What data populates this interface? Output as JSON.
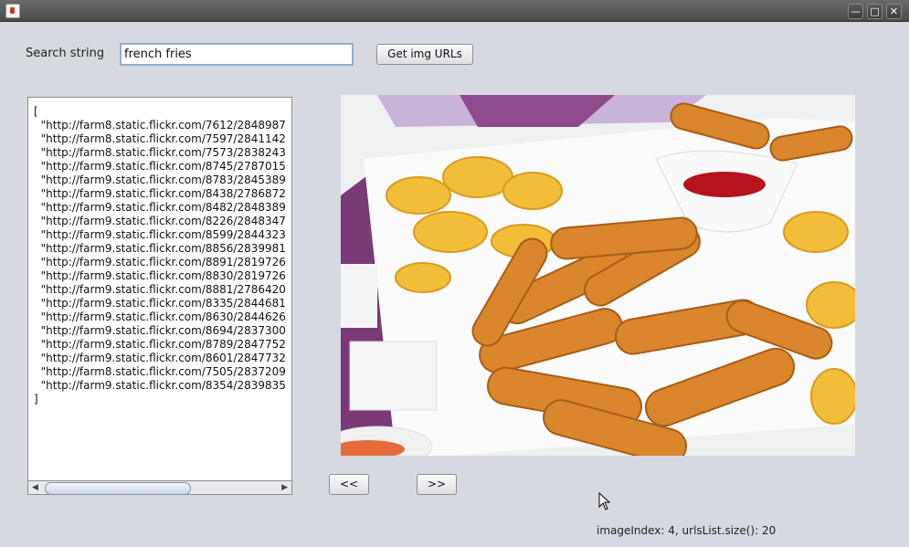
{
  "window": {
    "title": ""
  },
  "search": {
    "label": "Search string",
    "value": "french fries",
    "button": "Get img URLs"
  },
  "list": {
    "open_bracket": "[",
    "close_bracket": "]",
    "urls": [
      "\"http://farm8.static.flickr.com/7612/2848987",
      "\"http://farm8.static.flickr.com/7597/2841142",
      "\"http://farm8.static.flickr.com/7573/2838243",
      "\"http://farm9.static.flickr.com/8745/2787015",
      "\"http://farm9.static.flickr.com/8783/2845389",
      "\"http://farm9.static.flickr.com/8438/2786872",
      "\"http://farm9.static.flickr.com/8482/2848389",
      "\"http://farm9.static.flickr.com/8226/2848347",
      "\"http://farm9.static.flickr.com/8599/2844323",
      "\"http://farm9.static.flickr.com/8856/2839981",
      "\"http://farm9.static.flickr.com/8891/2819726",
      "\"http://farm9.static.flickr.com/8830/2819726",
      "\"http://farm9.static.flickr.com/8881/2786420",
      "\"http://farm9.static.flickr.com/8335/2844681",
      "\"http://farm9.static.flickr.com/8630/2844626",
      "\"http://farm9.static.flickr.com/8694/2837300",
      "\"http://farm9.static.flickr.com/8789/2847752",
      "\"http://farm9.static.flickr.com/8601/2847732",
      "\"http://farm8.static.flickr.com/7505/2837209",
      "\"http://farm9.static.flickr.com/8354/2839835"
    ]
  },
  "nav": {
    "prev": "<<",
    "next": ">>"
  },
  "status": "imageIndex: 4, urlsList.size(): 20",
  "icons": {
    "app": "java-icon",
    "minimize": "minimize-icon",
    "maximize": "maximize-icon",
    "close": "close-icon",
    "cursor": "mouse-cursor-icon"
  },
  "colors": {
    "background": "#d6d9df",
    "title_bar": "#4a4a4a",
    "input_border": "#8fb0d0"
  }
}
